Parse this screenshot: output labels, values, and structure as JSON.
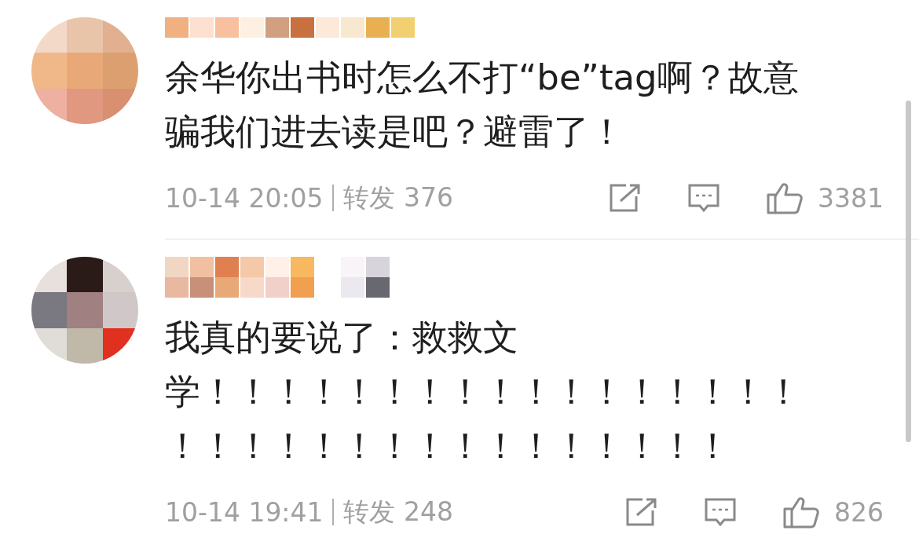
{
  "comments": [
    {
      "lines": [
        "余华你出书时怎么不打“be”tag啊？故意",
        "骗我们进去读是吧？避雷了！"
      ],
      "time": "10-14 20:05",
      "repost": "转发 376",
      "likes": "3381"
    },
    {
      "lines": [
        "我真的要说了：救救文",
        "学！！！！！！！！！！！！！！！！！",
        "！！！！！！！！！！！！！！！！"
      ],
      "time": "10-14 19:41",
      "repost": "转发 248",
      "likes": "826"
    }
  ]
}
